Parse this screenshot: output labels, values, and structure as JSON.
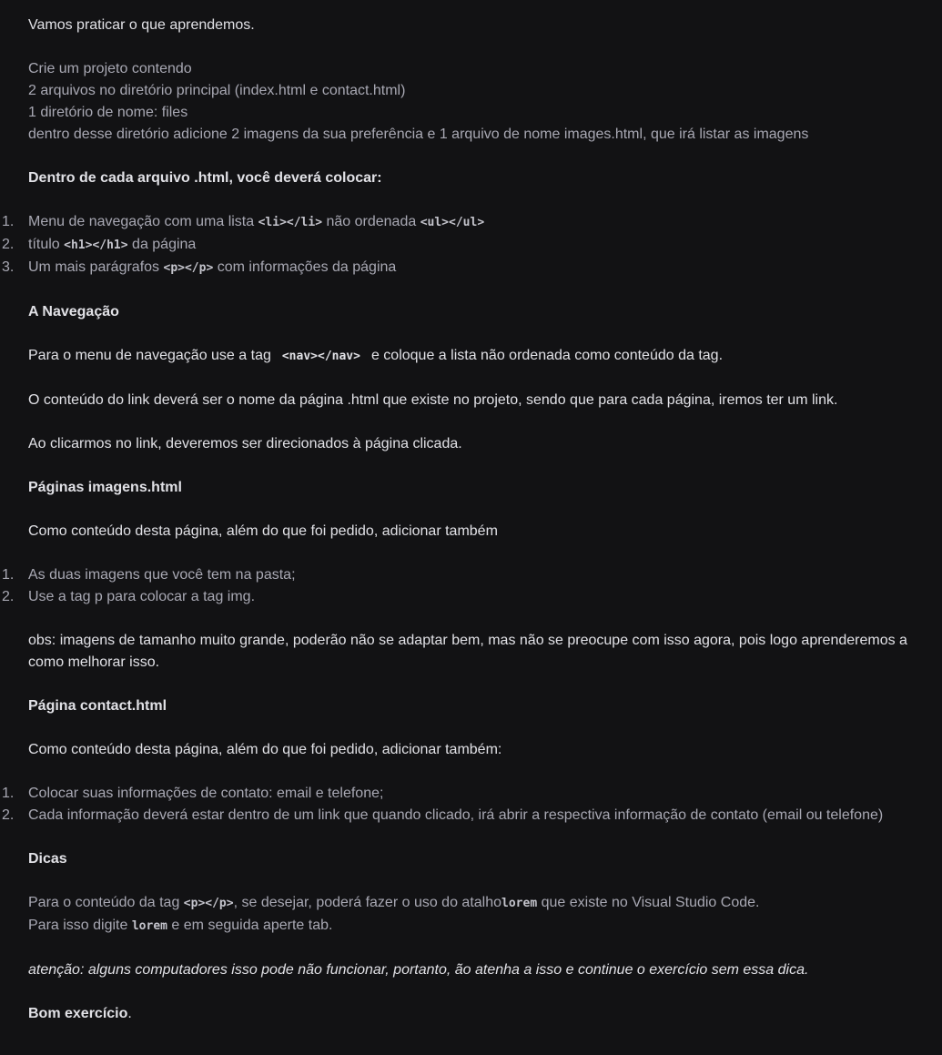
{
  "intro": "Vamos praticar o que aprendemos.",
  "project": [
    "Crie um projeto contendo",
    "2 arquivos no diretório principal (index.html e contact.html)",
    "1 diretório de nome: files",
    "dentro desse diretório adicione 2 imagens da sua preferência e 1 arquivo de nome images.html, que irá listar as imagens"
  ],
  "each_file_heading": "Dentro de cada arquivo .html, você deverá colocar:",
  "each_file_list": [
    {
      "num": "1.",
      "pre": "Menu de navegação com uma lista ",
      "code1": "<li></li>",
      "mid": " não ordenada ",
      "code2": "<ul></ul>",
      "post": ""
    },
    {
      "num": "2.",
      "pre": "título ",
      "code1": "<h1></h1>",
      "mid": " da página",
      "code2": "",
      "post": ""
    },
    {
      "num": "3.",
      "pre": "Um mais parágrafos ",
      "code1": "<p></p>",
      "mid": " com informações da página",
      "code2": "",
      "post": ""
    }
  ],
  "nav_heading": "A Navegação",
  "nav_p1_pre": "Para o menu de navegação use a tag",
  "nav_p1_code": "<nav></nav>",
  "nav_p1_post": "e coloque a lista não ordenada como conteúdo da tag.",
  "nav_p2": "O conteúdo do link deverá ser o nome da página .html que existe no projeto, sendo que para cada página, iremos ter um link.",
  "nav_p3": "Ao clicarmos no link, deveremos ser direcionados à página clicada.",
  "images_heading": "Páginas imagens.html",
  "images_p1": "Como conteúdo desta página, além do que foi pedido, adicionar também",
  "images_list": [
    {
      "num": "1.",
      "text": "As duas imagens que você tem na pasta;"
    },
    {
      "num": "2.",
      "text": "Use a tag p para colocar a tag img."
    }
  ],
  "images_obs": "obs: imagens de tamanho muito grande, poderão não se adaptar bem, mas não se preocupe com isso agora, pois logo aprenderemos a como melhorar isso.",
  "contact_heading": "Página contact.html",
  "contact_p1": "Como conteúdo desta página, além do que foi pedido, adicionar também:",
  "contact_list": [
    {
      "num": "1.",
      "text": "Colocar suas informações de contato: email e telefone;"
    },
    {
      "num": "2.",
      "text": "Cada informação deverá estar dentro de um link que quando clicado, irá abrir a respectiva informação de contato (email ou telefone)"
    }
  ],
  "tips_heading": "Dicas",
  "tips_p1_pre": "Para o conteúdo da tag ",
  "tips_p1_code1": "<p></p>",
  "tips_p1_mid": ", se desejar, poderá fazer o uso do atalho",
  "tips_p1_code2": "lorem",
  "tips_p1_post": " que existe no Visual Studio Code.",
  "tips_p2_pre": "Para isso digite ",
  "tips_p2_code": "lorem",
  "tips_p2_post": " e em seguida aperte tab.",
  "attention": "atenção: alguns computadores isso pode não funcionar, portanto, ão atenha a isso e continue o exercício sem essa dica.",
  "closing_bold": "Bom exercício",
  "closing_dot": "."
}
